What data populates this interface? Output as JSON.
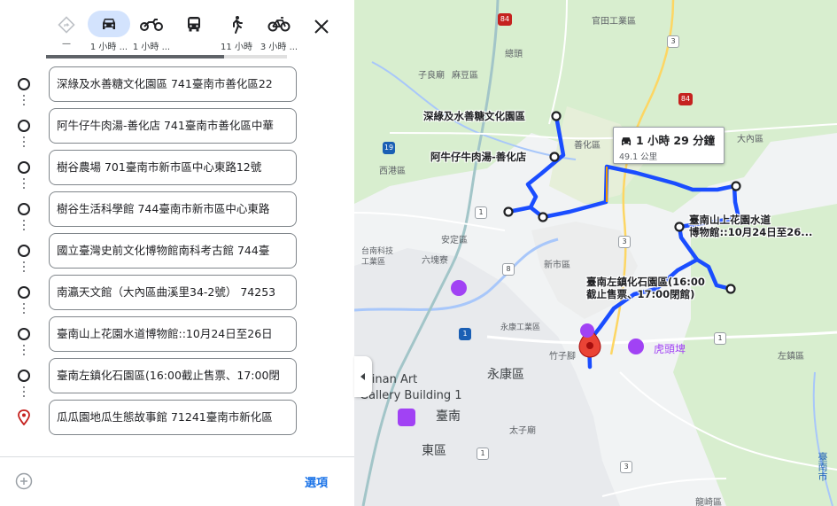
{
  "travel_modes": [
    {
      "name": "best",
      "time": "—",
      "active": false
    },
    {
      "name": "driving",
      "time": "1 小時 ...",
      "active": true
    },
    {
      "name": "motorcycle",
      "time": "1 小時 ...",
      "active": false
    },
    {
      "name": "transit",
      "time": "",
      "active": false
    },
    {
      "name": "walking",
      "time": "11 小時",
      "active": false
    },
    {
      "name": "cycling",
      "time": "3 小時 ...",
      "active": false
    }
  ],
  "progress": 0.74,
  "stops": [
    "深綠及水善糖文化園區 741臺南市善化區22",
    "阿牛仔牛肉湯-善化店 741臺南市善化區中華",
    "樹谷農場 701臺南市新市區中心東路12號",
    "樹谷生活科學館 744臺南市新市區中心東路",
    "國立臺灣史前文化博物館南科考古館 744臺",
    "南瀛天文館（大內區曲溪里34-2號） 74253",
    "臺南山上花園水道博物館::10月24日至26日",
    "臺南左鎮化石園區(16:00截止售票、17:00閉",
    "瓜瓜園地瓜生態故事館 71241臺南市新化區"
  ],
  "footer": {
    "options_label": "選項"
  },
  "route_info": {
    "duration": "1 小時 29 分鐘",
    "distance": "49.1 公里"
  },
  "colors": {
    "route": "#1a4dff",
    "accent": "#1a73e8",
    "active_mode": "#d3e3fd"
  },
  "map_labels": {
    "guantian": "官田工業區",
    "zigang": "子良廟",
    "madou": "麻豆區",
    "xiying": "西港區",
    "anding": "安定區",
    "tainan_tech": "台南科技\n工業區",
    "liujia": "六塊寮",
    "xinshi": "新市區",
    "shanhua": "善化區",
    "yongkang_ind": "永康工業區",
    "zhuqi": "竹子腳",
    "yongkang": "永康區",
    "tainan": "臺南",
    "dong": "東區",
    "taizi": "太子廟",
    "zuozhen": "左鎮區",
    "danei": "大內區",
    "longqi": "龍崎區",
    "tainan_city": "臺南市",
    "zhuotou": "總頭",
    "art_gallery": "Tainan Art\nGallery Building 1",
    "hutoupi": "虎頭埤"
  },
  "destinations": {
    "d1": "深綠及水善糖文化園區",
    "d2": "阿牛仔牛肉湯-善化店",
    "d7": "臺南山上花園水道\n博物館::10月24日至26...",
    "d8": "臺南左鎮化石園區(16:00\n截止售票、17:00閉館)"
  },
  "road_shields": [
    "84",
    "3",
    "19",
    "1",
    "8",
    "3",
    "1",
    "1",
    "3",
    "1",
    "84"
  ]
}
